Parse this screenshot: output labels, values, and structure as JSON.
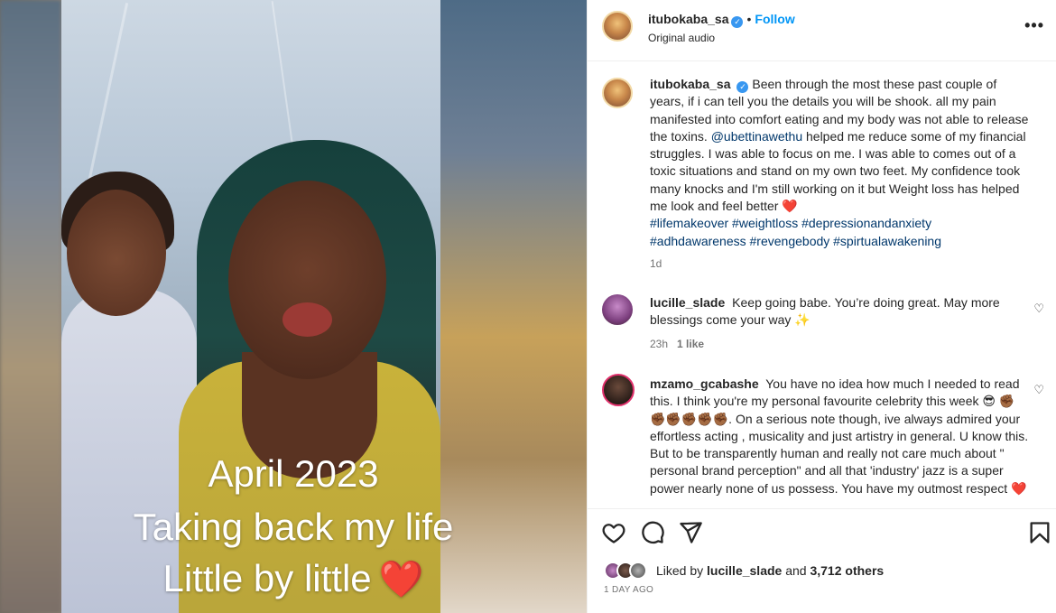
{
  "post": {
    "username": "itubokaba_sa",
    "verified": true,
    "follow_label": "Follow",
    "audio_label": "Original audio",
    "more_label": "•••"
  },
  "media": {
    "overlay_lines": [
      "April 2023",
      "Taking back my life",
      "Little by little"
    ],
    "overlay_emoji": "❤️"
  },
  "caption": {
    "username": "itubokaba_sa",
    "text_before_mention": "Been through the most these past couple of years, if i can tell you the details you will be shook. all my pain manifested into comfort eating and my body was not able to release the toxins.",
    "mention": "@ubettinawethu",
    "text_after_mention": "helped me reduce some of my financial struggles. I was able to focus on me. I was able to comes out of a toxic situations and stand on my own two feet. My confidence took many knocks and I'm still working on it but Weight loss has helped me look and feel better ❤️",
    "hashtags": "#lifemakeover #weightloss #depressionandanxiety #adhdawareness #revengebody #spirtualawakening",
    "time": "1d"
  },
  "comments": [
    {
      "username": "lucille_slade",
      "text": "Keep going babe. You’re doing great. May more blessings come your way ✨",
      "time": "23h",
      "likes": "1 like"
    },
    {
      "username": "mzamo_gcabashe",
      "text": "You have no idea how much I needed to read this. I think you're my personal favourite celebrity this week 😎 ✊🏾✊🏾✊🏾✊🏾✊🏾✊🏾. On a serious note though, ive always admired your effortless acting , musicality and just artistry in general. U know this. But to be transparently human and really not care much about \" personal brand perception\" and all that 'industry' jazz is a super power nearly none of us possess. You have my outmost respect ❤️"
    }
  ],
  "engagement": {
    "liked_by_prefix": "Liked by",
    "liked_by_user": "lucille_slade",
    "and_label": "and",
    "others_count": "3,712 others",
    "date": "1 DAY AGO"
  },
  "colors": {
    "accent": "#0095f6",
    "verified": "#3897f0",
    "link": "#00376b",
    "muted": "#737373"
  }
}
